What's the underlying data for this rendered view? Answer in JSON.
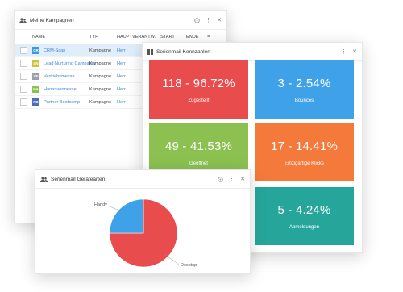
{
  "kampagnen": {
    "title": "Meine Kampagnen",
    "columns": [
      "NAME",
      "TYP",
      "HAUPTVERANTW.",
      "START",
      "ENDE"
    ],
    "rows": [
      {
        "badge": "CR",
        "badge_color": "#3a9bdc",
        "name": "CRM-Scan",
        "typ": "Kampagne",
        "haupt": "Herr",
        "selected": true
      },
      {
        "badge": "LN",
        "badge_color": "#c9c43a",
        "name": "Lead Nurturing Campaign",
        "typ": "Kampagne",
        "haupt": "Herr",
        "selected": false
      },
      {
        "badge": "VE",
        "badge_color": "#9aa1a8",
        "name": "Vertriebsmesse",
        "typ": "Kampagne",
        "haupt": "Herr",
        "selected": false
      },
      {
        "badge": "HA",
        "badge_color": "#8cc152",
        "name": "Hannovermesse",
        "typ": "Kampagne",
        "haupt": "Herr",
        "selected": false
      },
      {
        "badge": "PB",
        "badge_color": "#4a6fb5",
        "name": "Partner Bootcamp",
        "typ": "Kampagne",
        "haupt": "Herr",
        "selected": false
      }
    ]
  },
  "kennzahlen": {
    "title": "Serienmail Kennzahlen",
    "tiles": [
      {
        "value": "118 - 96.72%",
        "label": "Zugestellt",
        "color": "#e84c4c"
      },
      {
        "value": "3 - 2.54%",
        "label": "Bounces",
        "color": "#3fa2e8"
      },
      {
        "value": "49 - 41.53%",
        "label": "Geöffnet",
        "color": "#8cc152"
      },
      {
        "value": "17 - 14.41%",
        "label": "Einzigartige Klicks",
        "color": "#f47a3c"
      },
      {
        "value": "",
        "label": "",
        "color": "#8cc152"
      },
      {
        "value": "5 - 4.24%",
        "label": "Abmeldungen",
        "color": "#26a69a"
      }
    ]
  },
  "geraetearten": {
    "title": "Serienmail Gerätearten",
    "chart_data": {
      "type": "pie",
      "slices": [
        {
          "label": "Desktop",
          "value": 75,
          "color": "#e84c4c"
        },
        {
          "label": "Handy",
          "value": 25,
          "color": "#3fa2e8"
        }
      ]
    }
  }
}
